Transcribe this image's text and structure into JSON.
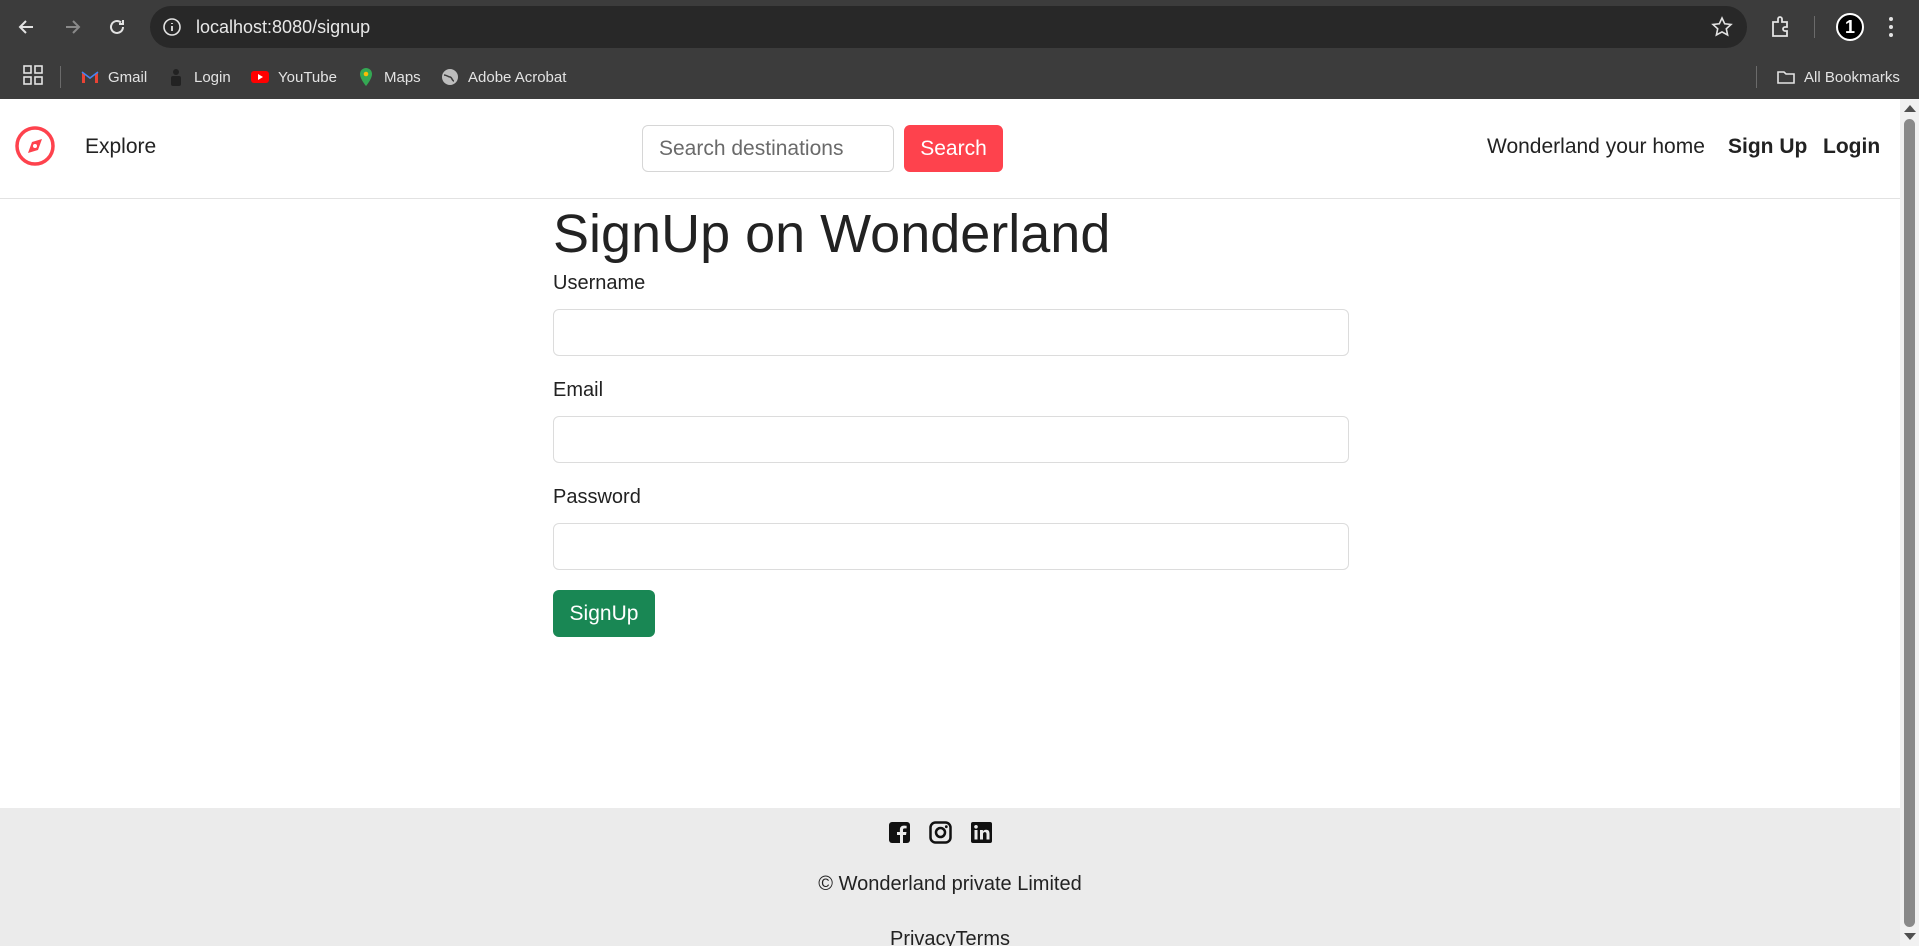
{
  "browser": {
    "url": "localhost:8080/signup",
    "profile_initial": "1",
    "bookmarks": [
      {
        "label": "Gmail",
        "icon": "gmail-icon"
      },
      {
        "label": "Login",
        "icon": "login-icon"
      },
      {
        "label": "YouTube",
        "icon": "youtube-icon"
      },
      {
        "label": "Maps",
        "icon": "maps-icon"
      },
      {
        "label": "Adobe Acrobat",
        "icon": "globe-icon"
      }
    ],
    "all_bookmarks": "All Bookmarks"
  },
  "navbar": {
    "explore": "Explore",
    "search_placeholder": "Search destinations",
    "search_button": "Search",
    "home_link": "Wonderland your home",
    "signup_link": "Sign Up",
    "login_link": "Login"
  },
  "form": {
    "title": "SignUp on Wonderland",
    "username_label": "Username",
    "email_label": "Email",
    "password_label": "Password",
    "submit_label": "SignUp"
  },
  "footer": {
    "socials": [
      "facebook-icon",
      "instagram-icon",
      "linkedin-icon"
    ],
    "copyright": "© Wonderland private Limited",
    "legal": "PrivacyTerms"
  },
  "colors": {
    "brand": "#fe424d",
    "submit": "#198754",
    "chrome": "#3c3c3c",
    "footer_bg": "#ebebeb"
  }
}
